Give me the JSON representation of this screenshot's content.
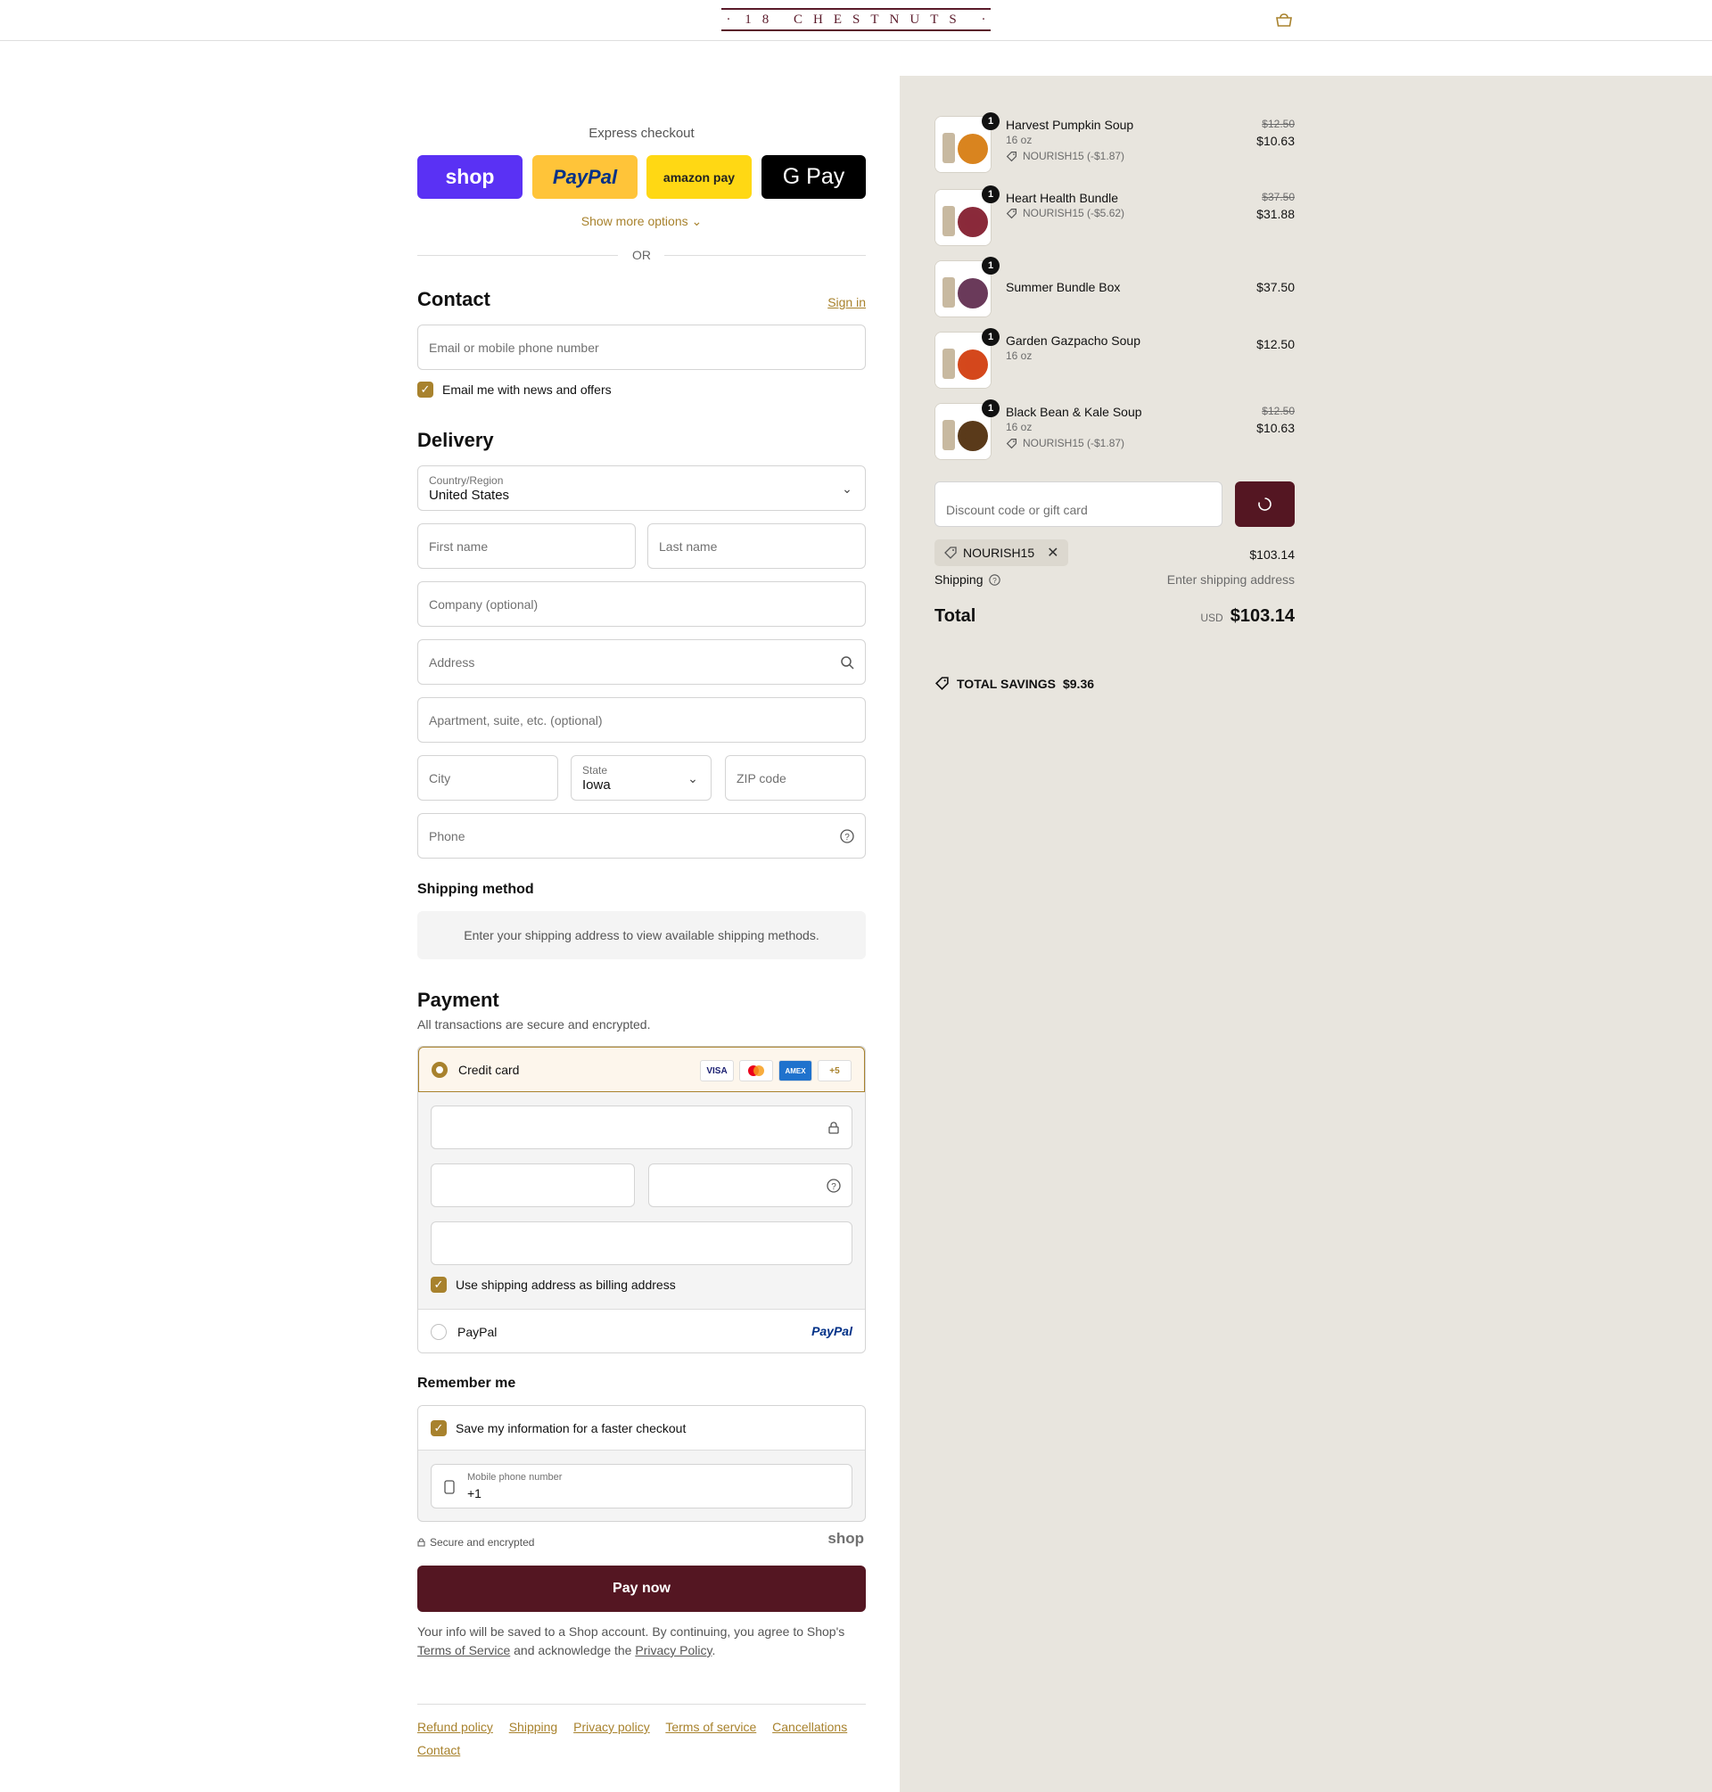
{
  "header": {
    "logo": "18 CHESTNUTS",
    "cart_icon": "bag-icon"
  },
  "express": {
    "title": "Express checkout",
    "shop": "shop",
    "paypal": "PayPal",
    "amazon": "amazon pay",
    "gpay": "G Pay",
    "more": "Show more options",
    "or": "OR"
  },
  "contact": {
    "title": "Contact",
    "sign_in": "Sign in",
    "email_placeholder": "Email or mobile phone number",
    "news_label": "Email me with news and offers"
  },
  "delivery": {
    "title": "Delivery",
    "country_label": "Country/Region",
    "country_value": "United States",
    "first_name": "First name",
    "last_name": "Last name",
    "company": "Company (optional)",
    "address": "Address",
    "apartment": "Apartment, suite, etc. (optional)",
    "city": "City",
    "state_label": "State",
    "state_value": "Iowa",
    "zip": "ZIP code",
    "phone": "Phone"
  },
  "shipping_method": {
    "title": "Shipping method",
    "info": "Enter your shipping address to view available shipping methods."
  },
  "payment": {
    "title": "Payment",
    "subtitle": "All transactions are secure and encrypted.",
    "credit_card": "Credit card",
    "cards": [
      "VISA",
      "MC",
      "AMEX",
      "+5"
    ],
    "billing_label": "Use shipping address as billing address",
    "paypal_label": "PayPal",
    "paypal_logo": "PayPal"
  },
  "remember": {
    "title": "Remember me",
    "save_label": "Save my information for a faster checkout",
    "phone_label": "Mobile phone number",
    "phone_value": "+1",
    "secure": "Secure and encrypted",
    "shop": "shop"
  },
  "pay_now": "Pay now",
  "legal": {
    "text1": "Your info will be saved to a Shop account. By continuing, you agree to Shop's",
    "tos": "Terms of Service",
    "text2": "and acknowledge the",
    "privacy": "Privacy Policy",
    "text3": "."
  },
  "footer": {
    "links": [
      "Refund policy",
      "Shipping",
      "Privacy policy",
      "Terms of service",
      "Cancellations",
      "Contact"
    ]
  },
  "summary": {
    "items": [
      {
        "name": "Harvest Pumpkin Soup",
        "variant": "16 oz",
        "discount": "NOURISH15 (-$1.87)",
        "old_price": "$12.50",
        "price": "$10.63",
        "qty": "1",
        "color": "#d9841f"
      },
      {
        "name": "Heart Health Bundle",
        "variant": "",
        "discount": "NOURISH15 (-$5.62)",
        "old_price": "$37.50",
        "price": "$31.88",
        "qty": "1",
        "color": "#8a2a3a"
      },
      {
        "name": "Summer Bundle Box",
        "variant": "",
        "discount": "",
        "old_price": "",
        "price": "$37.50",
        "qty": "1",
        "color": "#6a3a5a"
      },
      {
        "name": "Garden Gazpacho Soup",
        "variant": "16 oz",
        "discount": "",
        "old_price": "",
        "price": "$12.50",
        "qty": "1",
        "color": "#d4481c"
      },
      {
        "name": "Black Bean & Kale Soup",
        "variant": "16 oz",
        "discount": "NOURISH15 (-$1.87)",
        "old_price": "$12.50",
        "price": "$10.63",
        "qty": "1",
        "color": "#5a3a1a"
      }
    ],
    "discount_placeholder": "Discount code or gift card",
    "code": "NOURISH15",
    "subtotal": "$103.14",
    "shipping_label": "Shipping",
    "shipping_value": "Enter shipping address",
    "total_label": "Total",
    "currency": "USD",
    "total": "$103.14",
    "savings_label": "TOTAL SAVINGS",
    "savings": "$9.36"
  },
  "colors": {
    "accent": "#a8822d",
    "brand": "#541622",
    "sidebar": "#e8e5de"
  }
}
